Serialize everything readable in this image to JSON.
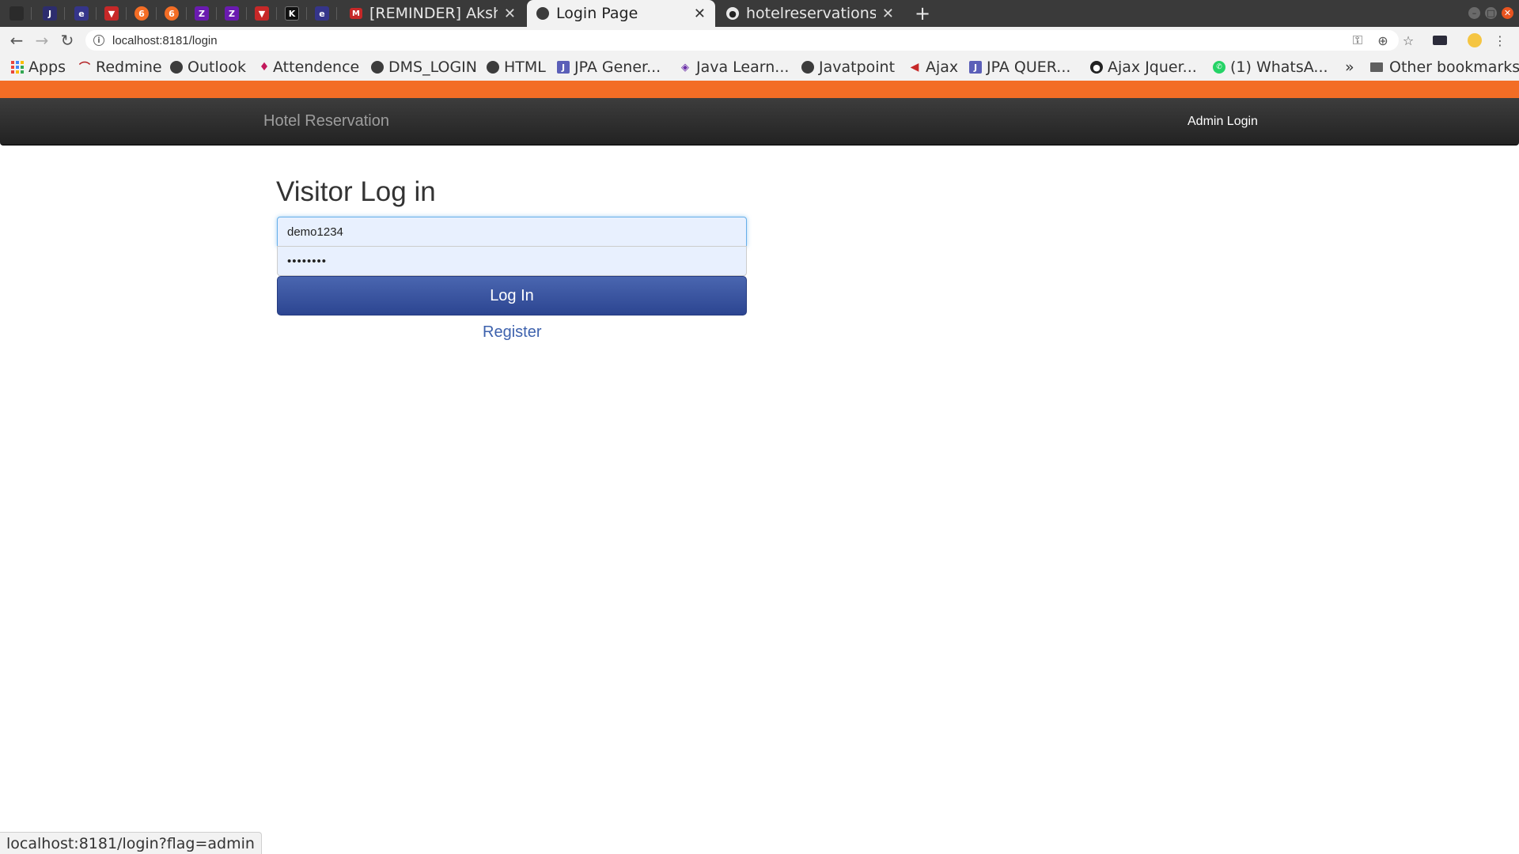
{
  "browser": {
    "pinned_tabs": [
      {
        "icon": "jira-icon",
        "glyph": "J",
        "bg": "#2d2d6e"
      },
      {
        "icon": "eclipse-icon",
        "glyph": "e",
        "bg": "#35358a"
      },
      {
        "icon": "vivaldi-icon",
        "glyph": "▼",
        "bg": "#c62828"
      },
      {
        "icon": "gitlab-icon",
        "glyph": "6",
        "bg": "#f36d25"
      },
      {
        "icon": "gitlab-icon",
        "glyph": "6",
        "bg": "#f36d25"
      },
      {
        "icon": "purple-app-icon",
        "glyph": "Z",
        "bg": "#6a1bb0"
      },
      {
        "icon": "purple-app-icon",
        "glyph": "Z",
        "bg": "#6a1bb0"
      },
      {
        "icon": "vivaldi-icon",
        "glyph": "▼",
        "bg": "#c62828"
      },
      {
        "icon": "k-icon",
        "glyph": "K",
        "bg": "#111111"
      },
      {
        "icon": "eclipse-icon",
        "glyph": "e",
        "bg": "#35358a"
      }
    ],
    "tabs": [
      {
        "title": "[REMINDER] Akshay",
        "icon": "gmail-icon",
        "active": false
      },
      {
        "title": "Login Page",
        "icon": "globe-icon",
        "active": true
      },
      {
        "title": "hotelreservationsys",
        "icon": "github-icon",
        "active": false
      }
    ],
    "new_tab_label": "+",
    "url": "localhost:8181/login",
    "bookmarks": [
      {
        "label": "Apps",
        "icon": "apps-grid-icon"
      },
      {
        "label": "Redmine",
        "icon": "redmine-icon"
      },
      {
        "label": "Outlook",
        "icon": "globe-icon"
      },
      {
        "label": "Attendence",
        "icon": "attendence-icon"
      },
      {
        "label": "DMS_LOGIN",
        "icon": "globe-icon"
      },
      {
        "label": "HTML",
        "icon": "globe-icon"
      },
      {
        "label": "JPA Gener...",
        "icon": "jpa-icon"
      },
      {
        "label": "Java Learn...",
        "icon": "java-icon"
      },
      {
        "label": "Javatpoint",
        "icon": "globe-icon"
      },
      {
        "label": "Ajax",
        "icon": "ajax-icon"
      },
      {
        "label": "JPA QUER...",
        "icon": "jpa-icon"
      },
      {
        "label": "Ajax Jquer...",
        "icon": "github-icon"
      },
      {
        "label": "(1) WhatsA...",
        "icon": "whatsapp-icon"
      },
      {
        "label": "»",
        "icon": "overflow-icon"
      },
      {
        "label": "Other bookmarks",
        "icon": "folder-icon"
      }
    ],
    "status_text": "localhost:8181/login?flag=admin"
  },
  "page": {
    "brand": "Hotel Reservation",
    "admin_link": "Admin Login",
    "heading": "Visitor Log in",
    "username_value": "demo1234",
    "password_value": "••••••••",
    "login_button": "Log In",
    "register_link": "Register",
    "accent_color": "#f36d25",
    "button_color": "#3a56a3"
  }
}
